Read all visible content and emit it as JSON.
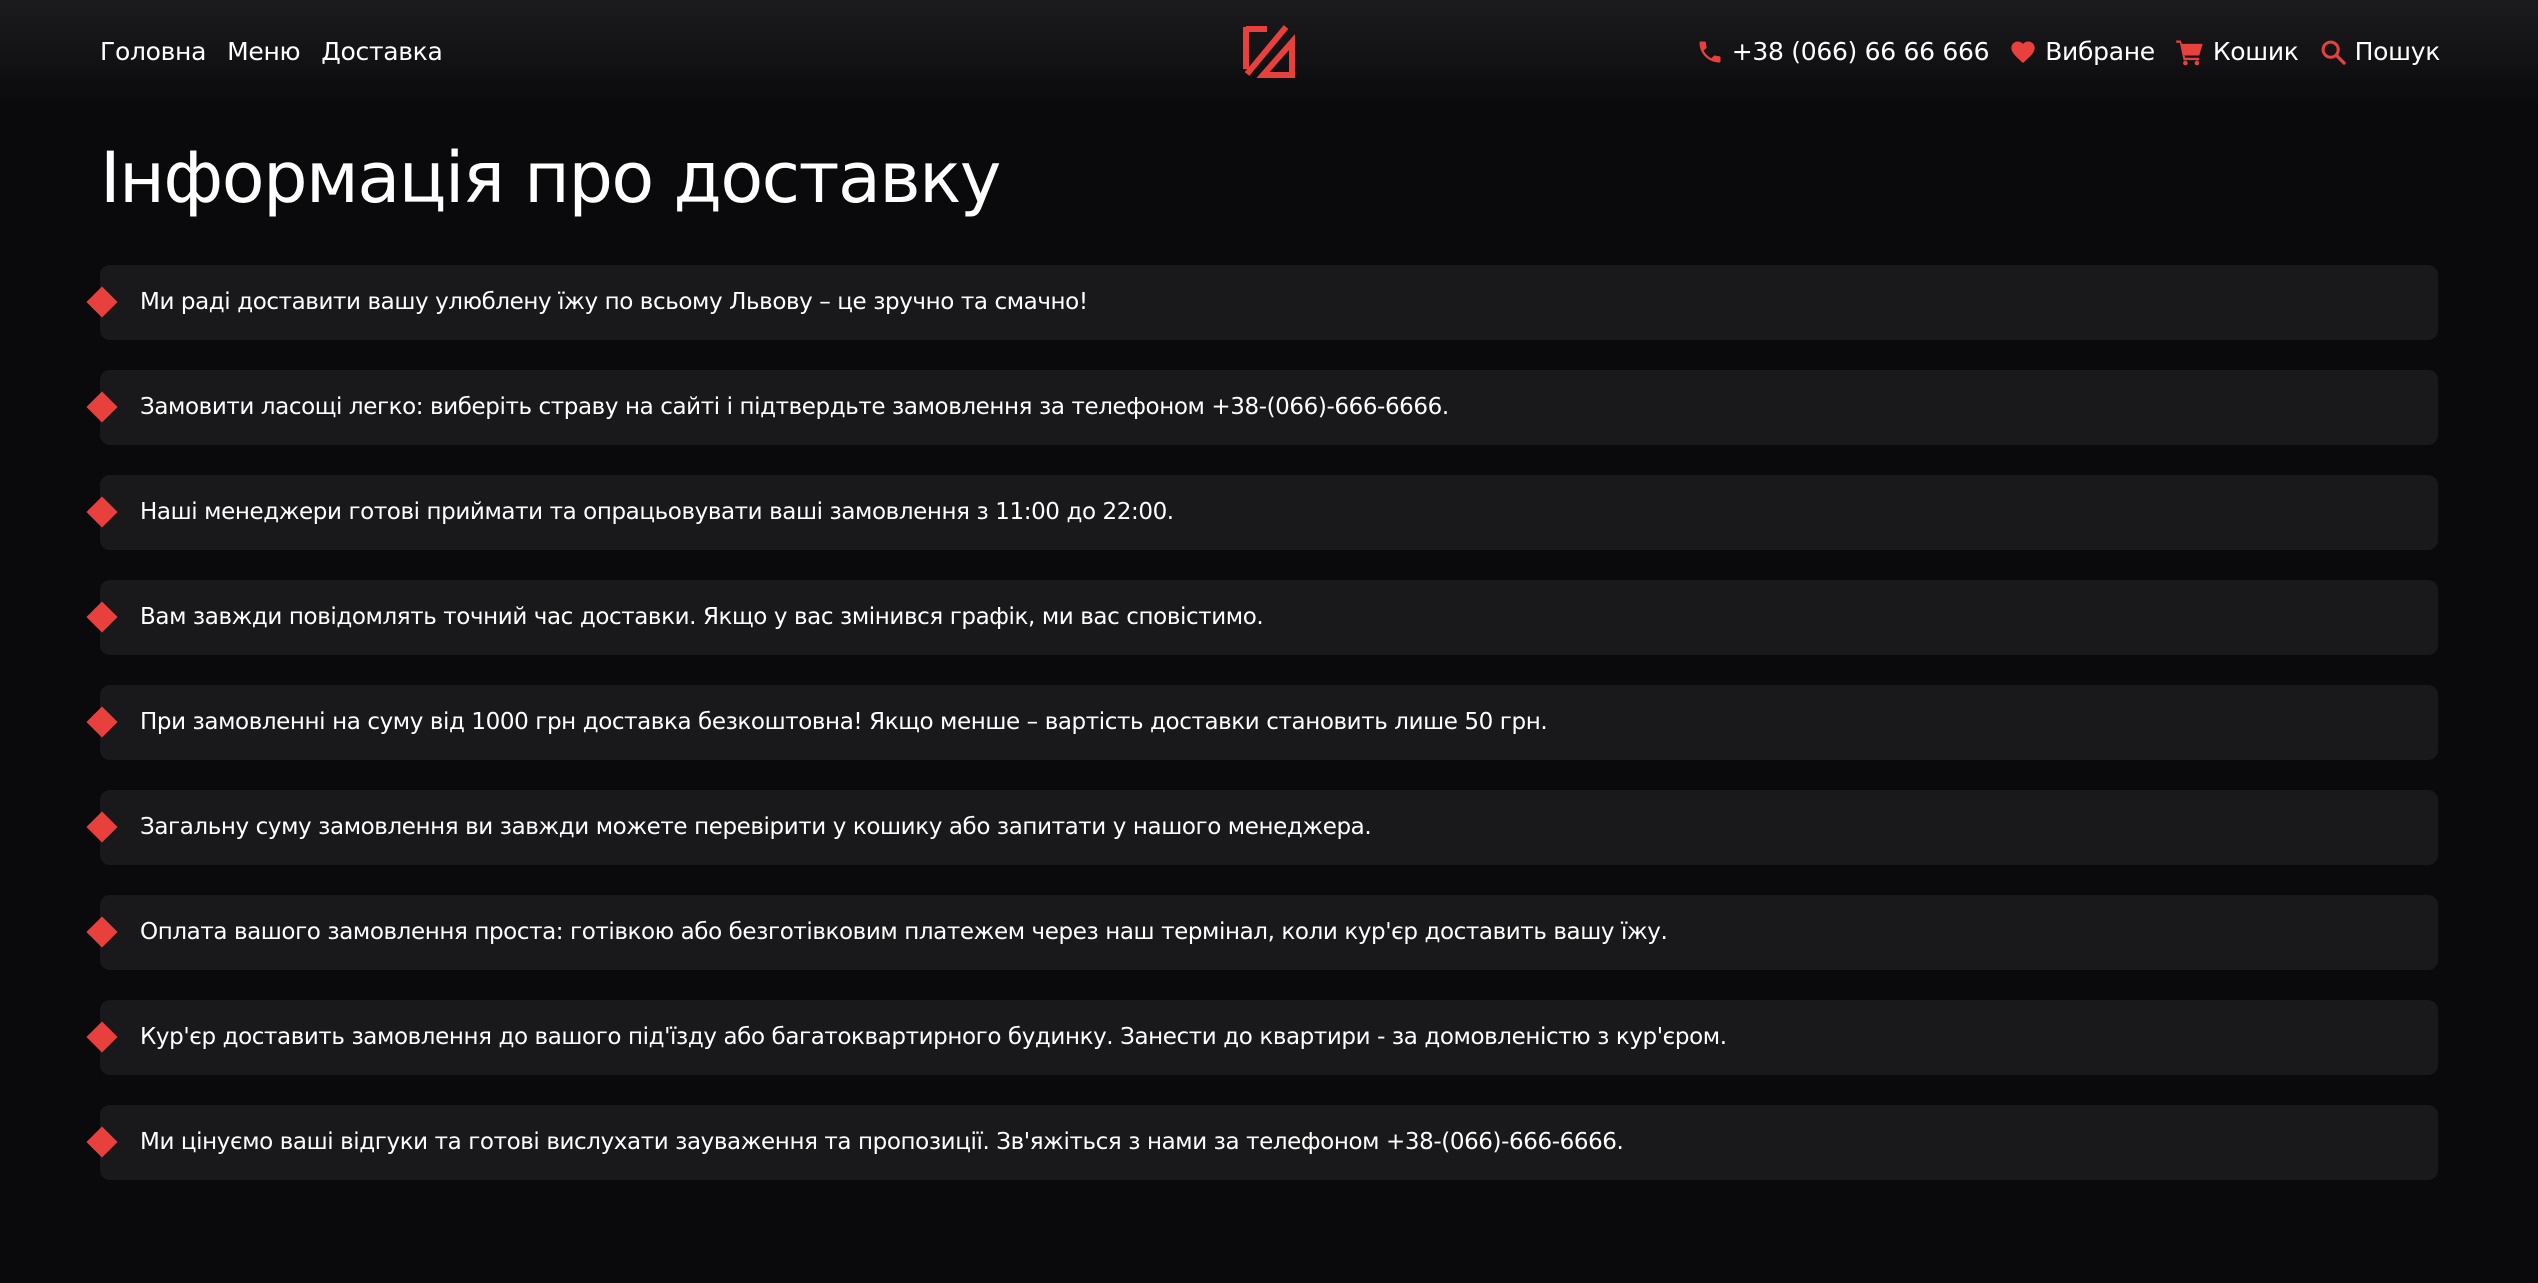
{
  "theme": {
    "accent": "#e8403d",
    "background": "#0a0a0c",
    "card": "#19191c",
    "text": "#ffffff"
  },
  "header": {
    "nav": [
      {
        "label": "Головна"
      },
      {
        "label": "Меню"
      },
      {
        "label": "Доставка"
      }
    ],
    "logo_icon": "brand-logo-icon",
    "phone": {
      "icon": "phone-icon",
      "label": "+38 (066) 66 66 666"
    },
    "favorites": {
      "icon": "heart-icon",
      "label": "Вибране"
    },
    "cart": {
      "icon": "cart-icon",
      "label": "Кошик"
    },
    "search": {
      "icon": "search-icon",
      "label": "Пошук"
    }
  },
  "main": {
    "title": "Інформація про доставку",
    "items": [
      "Ми раді доставити вашу улюблену їжу по всьому Львову – це зручно та смачно!",
      "Замовити ласощі легко: виберіть страву на сайті і підтвердьте замовлення за телефоном +38-(066)-666-6666.",
      "Наші менеджери готові приймати та опрацьовувати ваші замовлення з 11:00 до 22:00.",
      "Вам завжди повідомлять точний час доставки. Якщо у вас змінився графік, ми вас сповістимо.",
      "При замовленні на суму від 1000 грн доставка безкоштовна! Якщо менше – вартість доставки становить лише 50 грн.",
      "Загальну суму замовлення ви завжди можете перевірити у кошику або запитати у нашого менеджера.",
      "Оплата вашого замовлення проста: готівкою або безготівковим платежем через наш термінал, коли кур'єр доставить вашу їжу.",
      "Кур'єр доставить замовлення до вашого під'їзду або багатоквартирного будинку. Занести до квартири - за домовленістю з кур'єром.",
      "Ми цінуємо ваші відгуки та готові вислухати зауваження та пропозиції. Зв'яжіться з нами за телефоном +38-(066)-666-6666."
    ]
  }
}
